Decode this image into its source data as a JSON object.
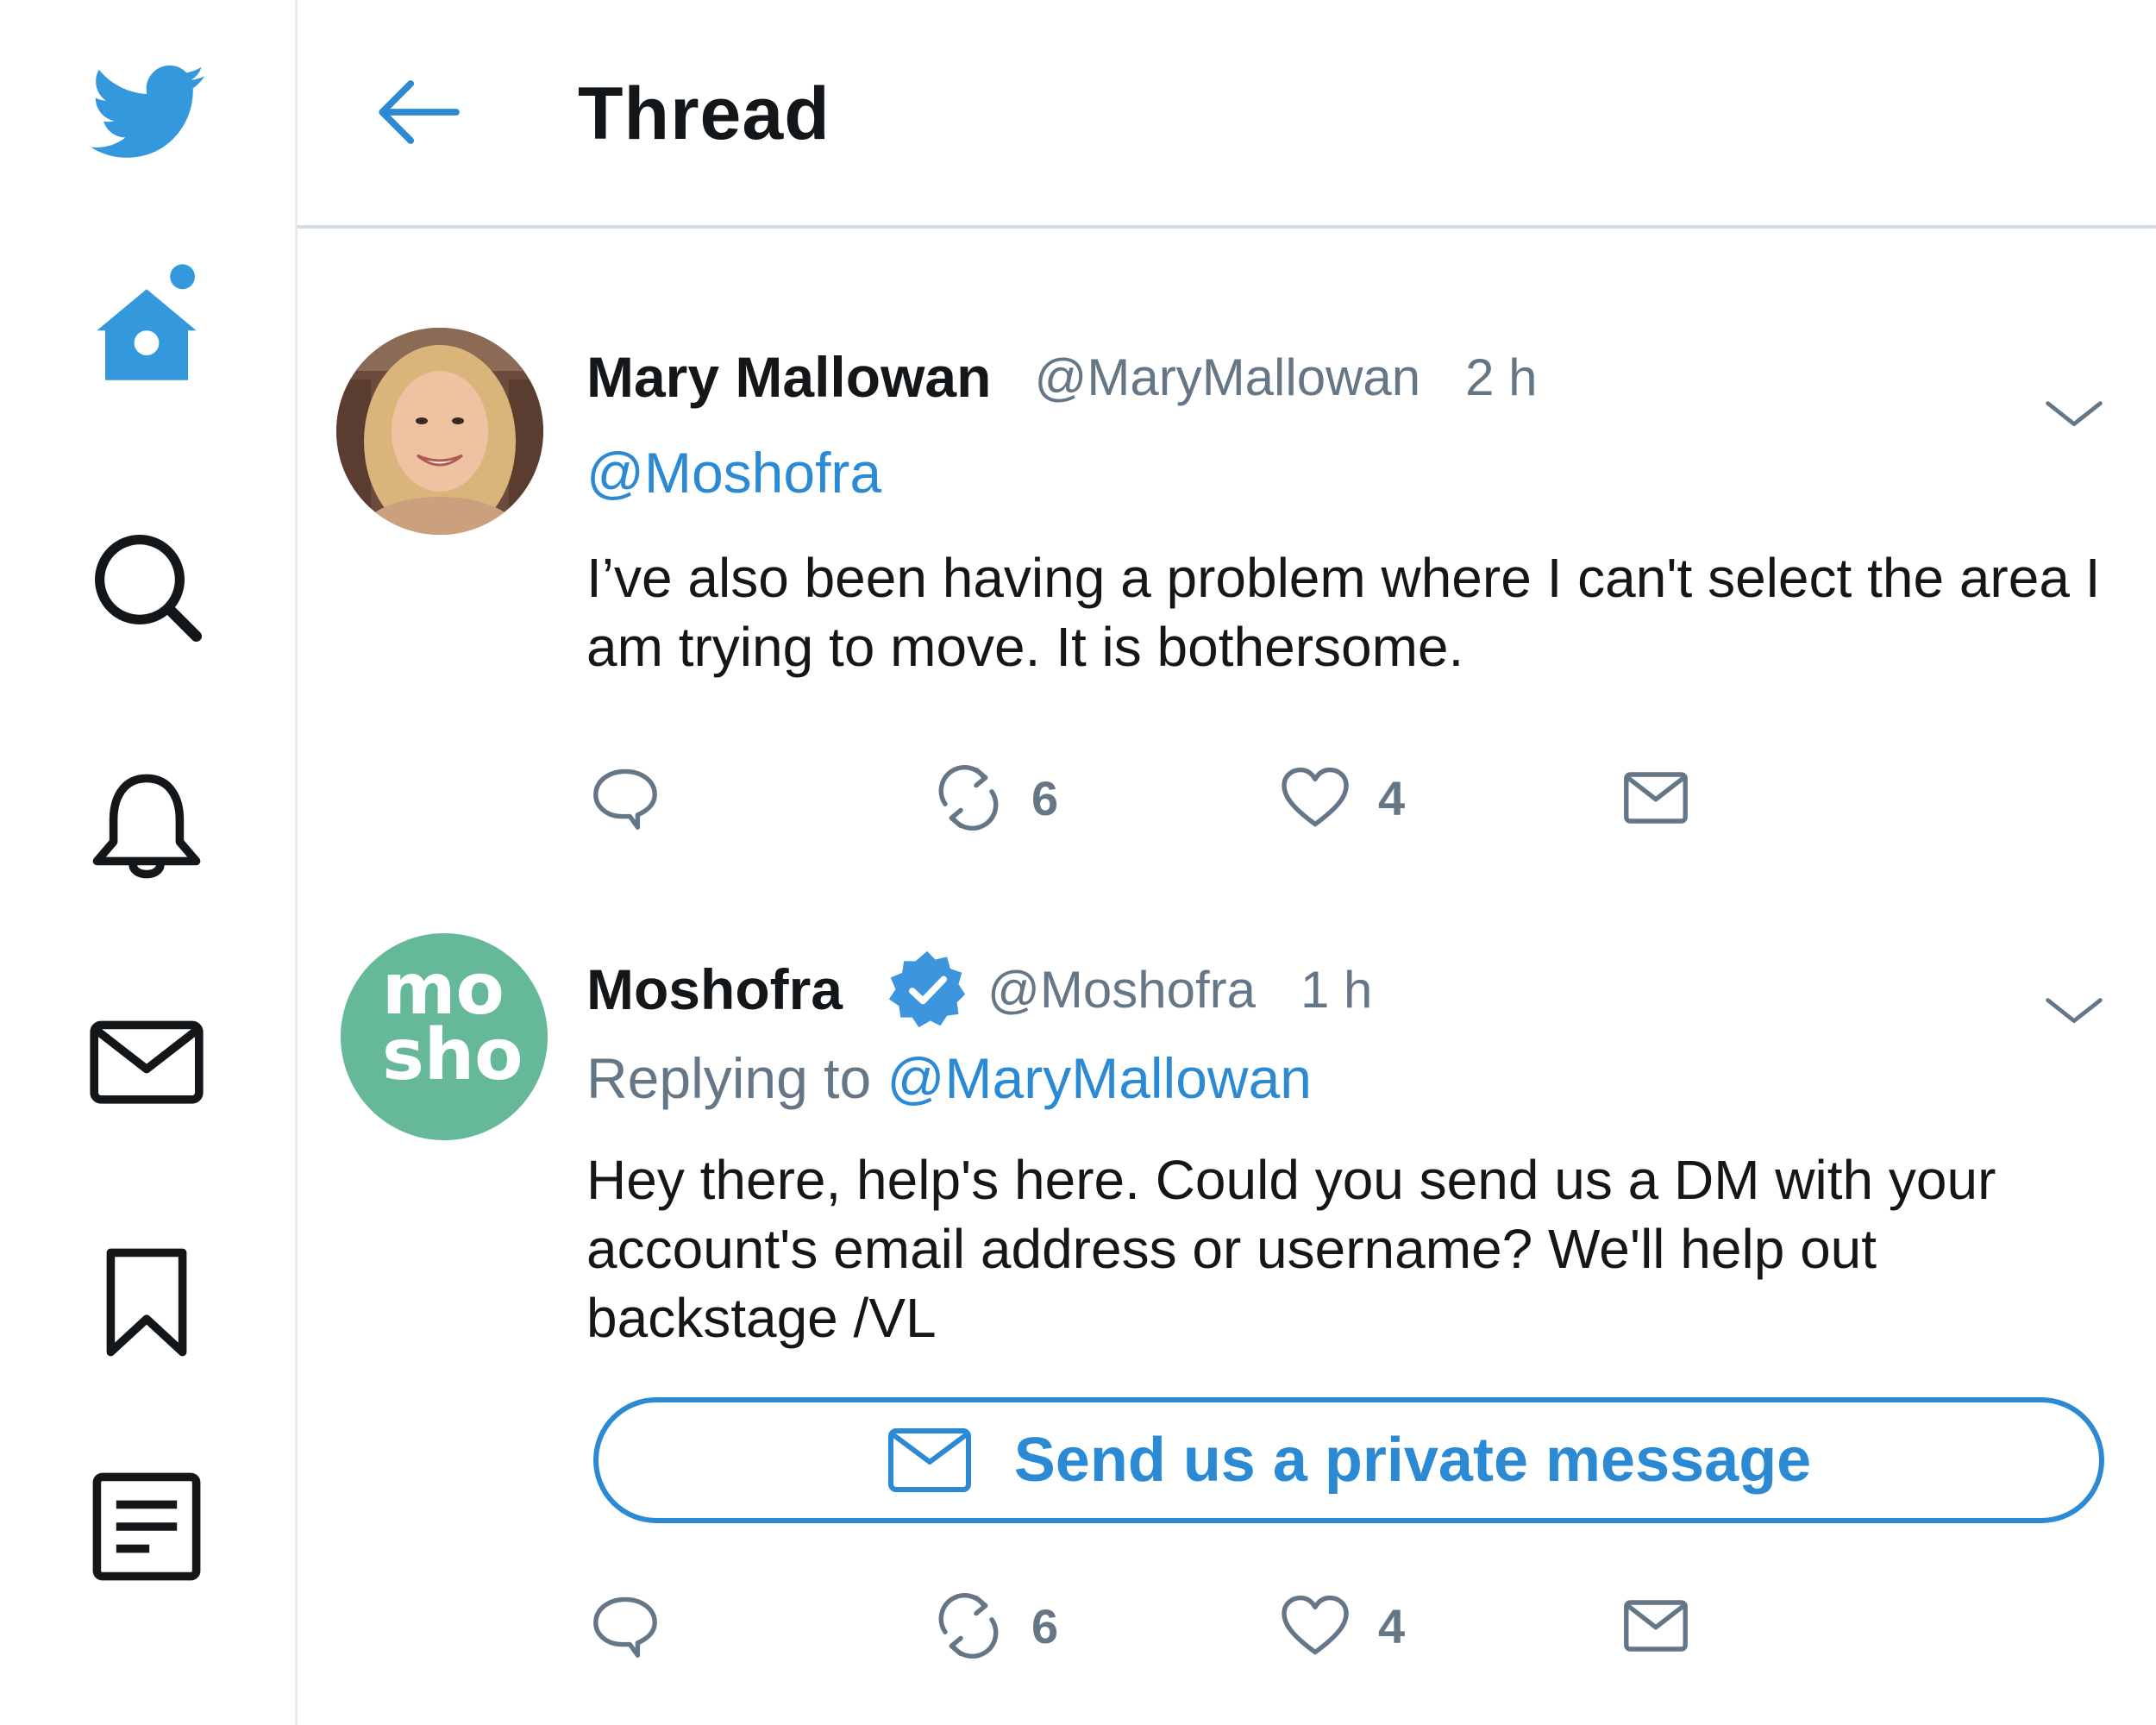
{
  "header": {
    "title": "Thread"
  },
  "tweets": [
    {
      "display_name": "Mary Mallowan",
      "handle": "@MaryMallowan",
      "time": "2 h",
      "mention": "@Moshofra",
      "text": "I’ve also been having a problem where I can't select the area I am trying to move. It is bothersome.",
      "retweets": "6",
      "likes": "4"
    },
    {
      "display_name": "Moshofra",
      "verified": true,
      "avatar_text": [
        "mo",
        "sho"
      ],
      "handle": "@Moshofra",
      "time": "1 h",
      "replying_to_label": "Replying to",
      "replying_to_handle": "@MaryMallowan",
      "text": "Hey there, help's here. Could you send us a DM with your account's email address or username? We'll help out backstage /VL",
      "dm_button_label": "Send us a private message",
      "retweets": "6",
      "likes": "4"
    }
  ],
  "colors": {
    "accent": "#2b8ad3",
    "twitter_blue": "#1da1f2",
    "muted_text": "#657786",
    "brand_avatar_green": "#65b999"
  },
  "icons": {
    "nav": [
      "twitter-bird-icon",
      "home-icon",
      "search-icon",
      "bell-icon",
      "mail-icon",
      "bookmark-icon",
      "lists-icon"
    ],
    "tweet_actions": [
      "reply-icon",
      "retweet-icon",
      "like-icon",
      "dm-icon"
    ]
  }
}
